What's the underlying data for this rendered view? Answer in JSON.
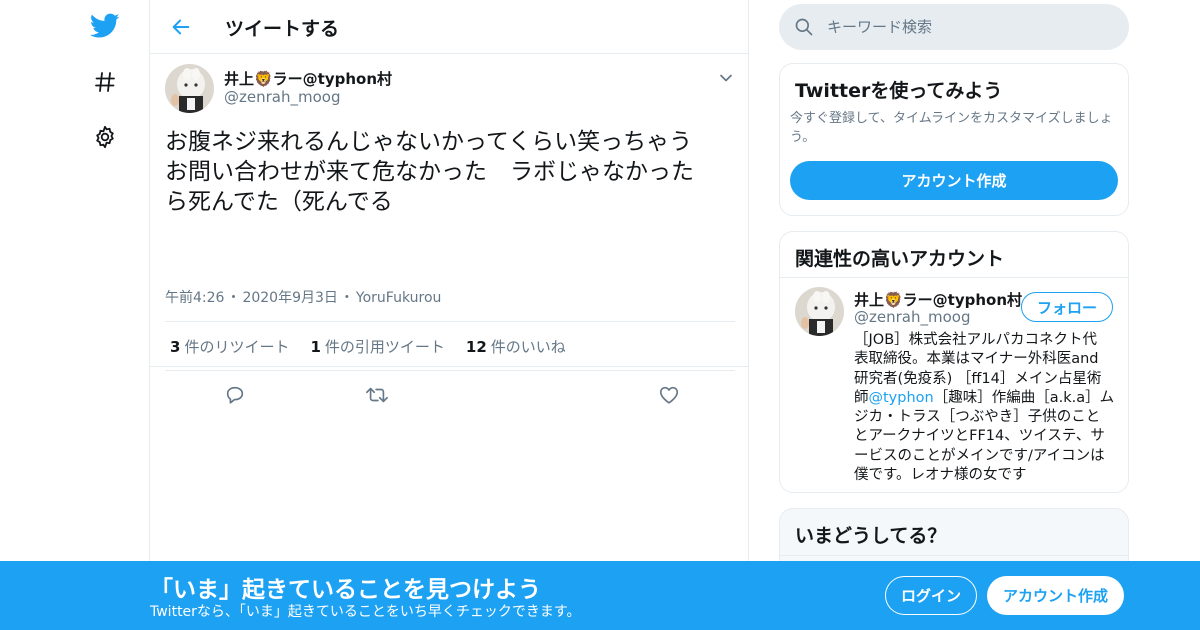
{
  "nav": {
    "items": [
      {
        "icon": "twitter-bird-icon"
      },
      {
        "icon": "hashtag-icon"
      },
      {
        "icon": "gear-icon"
      }
    ]
  },
  "header": {
    "title": "ツイートする"
  },
  "tweet": {
    "author_name": "井上🦁ラー@typhon村",
    "author_handle": "@zenrah_moog",
    "text_lines": [
      "お腹ネジ来れるんじゃないかってくらい笑っちゃう",
      "お問い合わせが来て危なかった　ラボじゃなかった",
      "ら死んでた（死んでる"
    ],
    "time": "午前4:26",
    "date": "2020年9月3日",
    "source": "YoruFukurou",
    "separator": "・",
    "stats": [
      {
        "count": "3",
        "label": "件のリツイート"
      },
      {
        "count": "1",
        "label": "件の引用ツイート"
      },
      {
        "count": "12",
        "label": "件のいいね"
      }
    ]
  },
  "search": {
    "placeholder": "キーワード検索"
  },
  "signup_card": {
    "title": "Twitterを使ってみよう",
    "description": "今すぐ登録して、タイムラインをカスタマイズしましょう。",
    "button_label": "アカウント作成"
  },
  "related_card": {
    "title": "関連性の高いアカウント",
    "name": "井上🦁ラー@typhon村",
    "handle": "@zenrah_moog",
    "follow_label": "フォロー",
    "bio_lines": [
      {
        "pre": "［JOB］株式会社アルパカコネクト代",
        "link": "",
        "post": ""
      },
      {
        "pre": "表取締役。本業はマイナー外科医and",
        "link": "",
        "post": ""
      },
      {
        "pre": "研究者(免疫系) ［ff14］メイン占星術",
        "link": "",
        "post": ""
      },
      {
        "pre": "師",
        "link": "@typhon",
        "post": "［趣味］作編曲［a.k.a］ム"
      },
      {
        "pre": "ジカ・トラス［つぶやき］子供のこと",
        "link": "",
        "post": ""
      },
      {
        "pre": "とアークナイツとFF14、ツイステ、サ",
        "link": "",
        "post": ""
      },
      {
        "pre": "ービスのことがメインです/アイコンは",
        "link": "",
        "post": ""
      },
      {
        "pre": "僕です。レオナ様の女です",
        "link": "",
        "post": ""
      }
    ]
  },
  "trend_card": {
    "title": "いまどうしてる？"
  },
  "banner": {
    "title": "「いま」起きていることを見つけよう",
    "subtitle": "Twitterなら、「いま」起きていることをいち早くチェックできます。",
    "login_label": "ログイン",
    "signup_label": "アカウント作成"
  },
  "colors": {
    "brand": "#1da1f2",
    "text": "#14171a",
    "secondary": "#657786",
    "border": "#e6ecf0"
  }
}
